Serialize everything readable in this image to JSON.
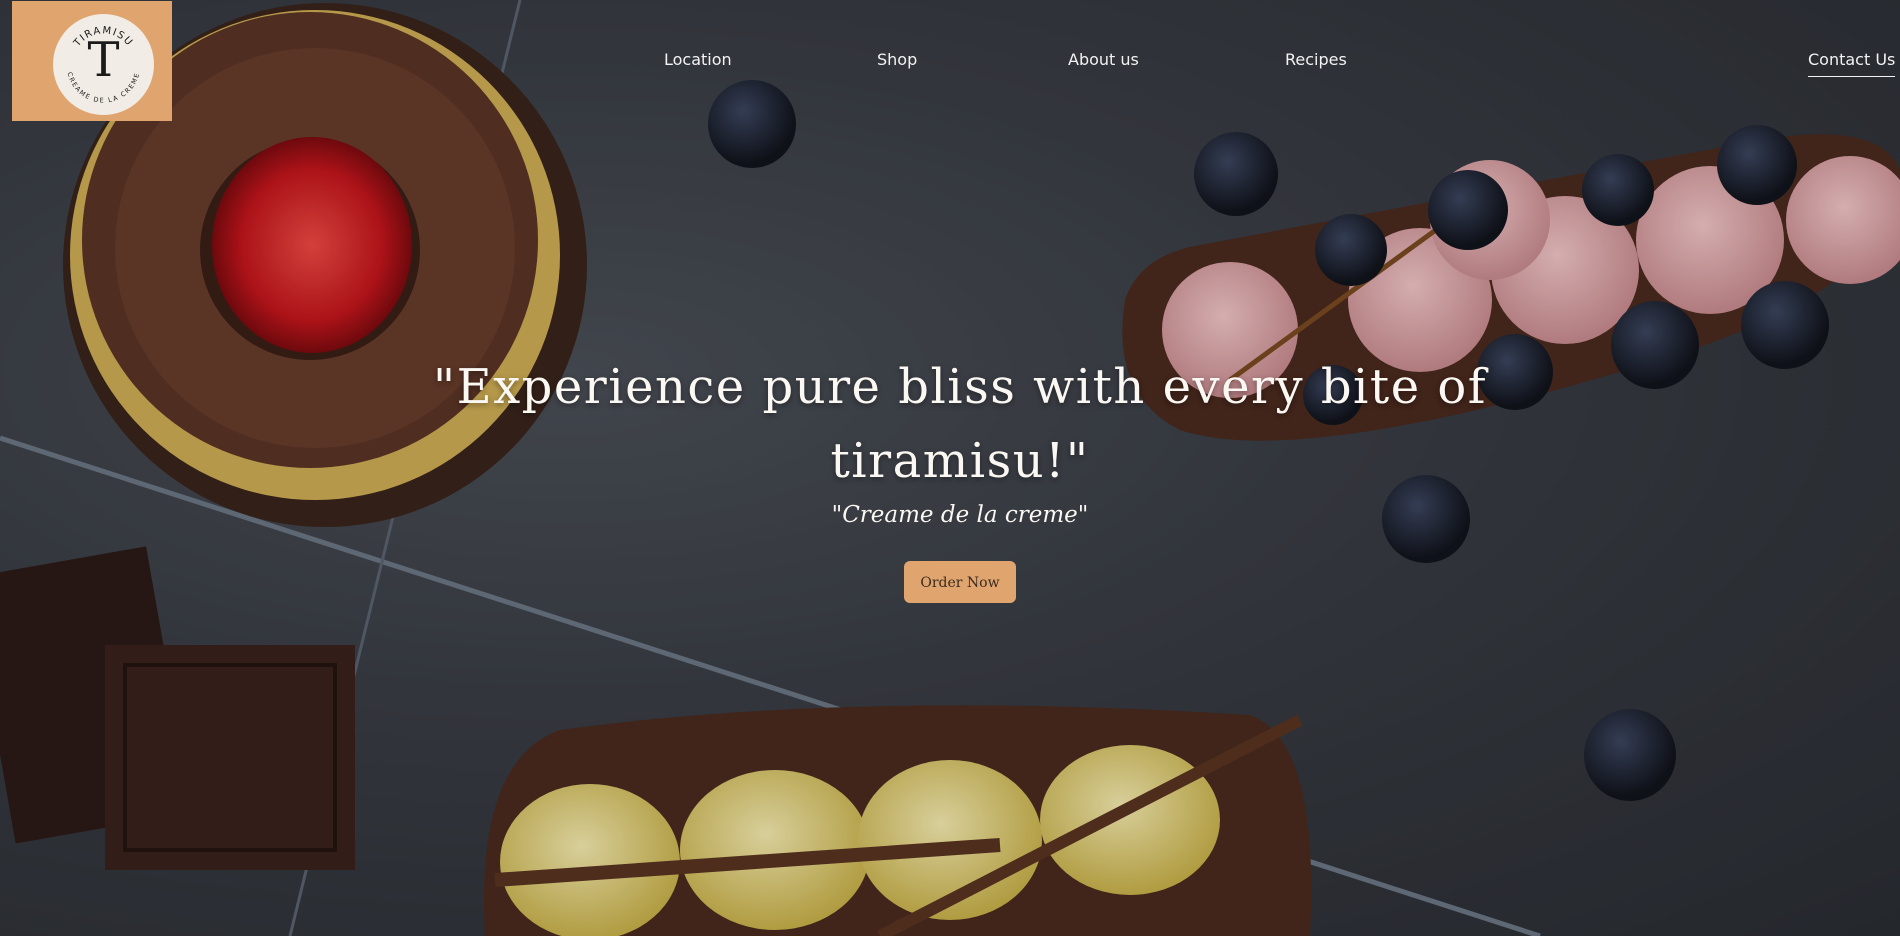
{
  "brand": {
    "name": "TIRAMISU",
    "monogram": "T",
    "subtitle": "CREAME DE LA CREME",
    "logo_bg": "#e0a56f"
  },
  "nav": {
    "items": [
      {
        "label": "Location"
      },
      {
        "label": "Shop"
      },
      {
        "label": "About us"
      },
      {
        "label": "Recipes"
      },
      {
        "label": "Contact Us",
        "active": true
      }
    ]
  },
  "hero": {
    "headline_line1": "\"Experience pure bliss with every bite of",
    "headline_line2": "tiramisu!\"",
    "tagline": "\"Creame de la creme\"",
    "cta_label": "Order Now",
    "cta_color": "#e0a56f",
    "background_image": "dessert-tarts-photo"
  }
}
